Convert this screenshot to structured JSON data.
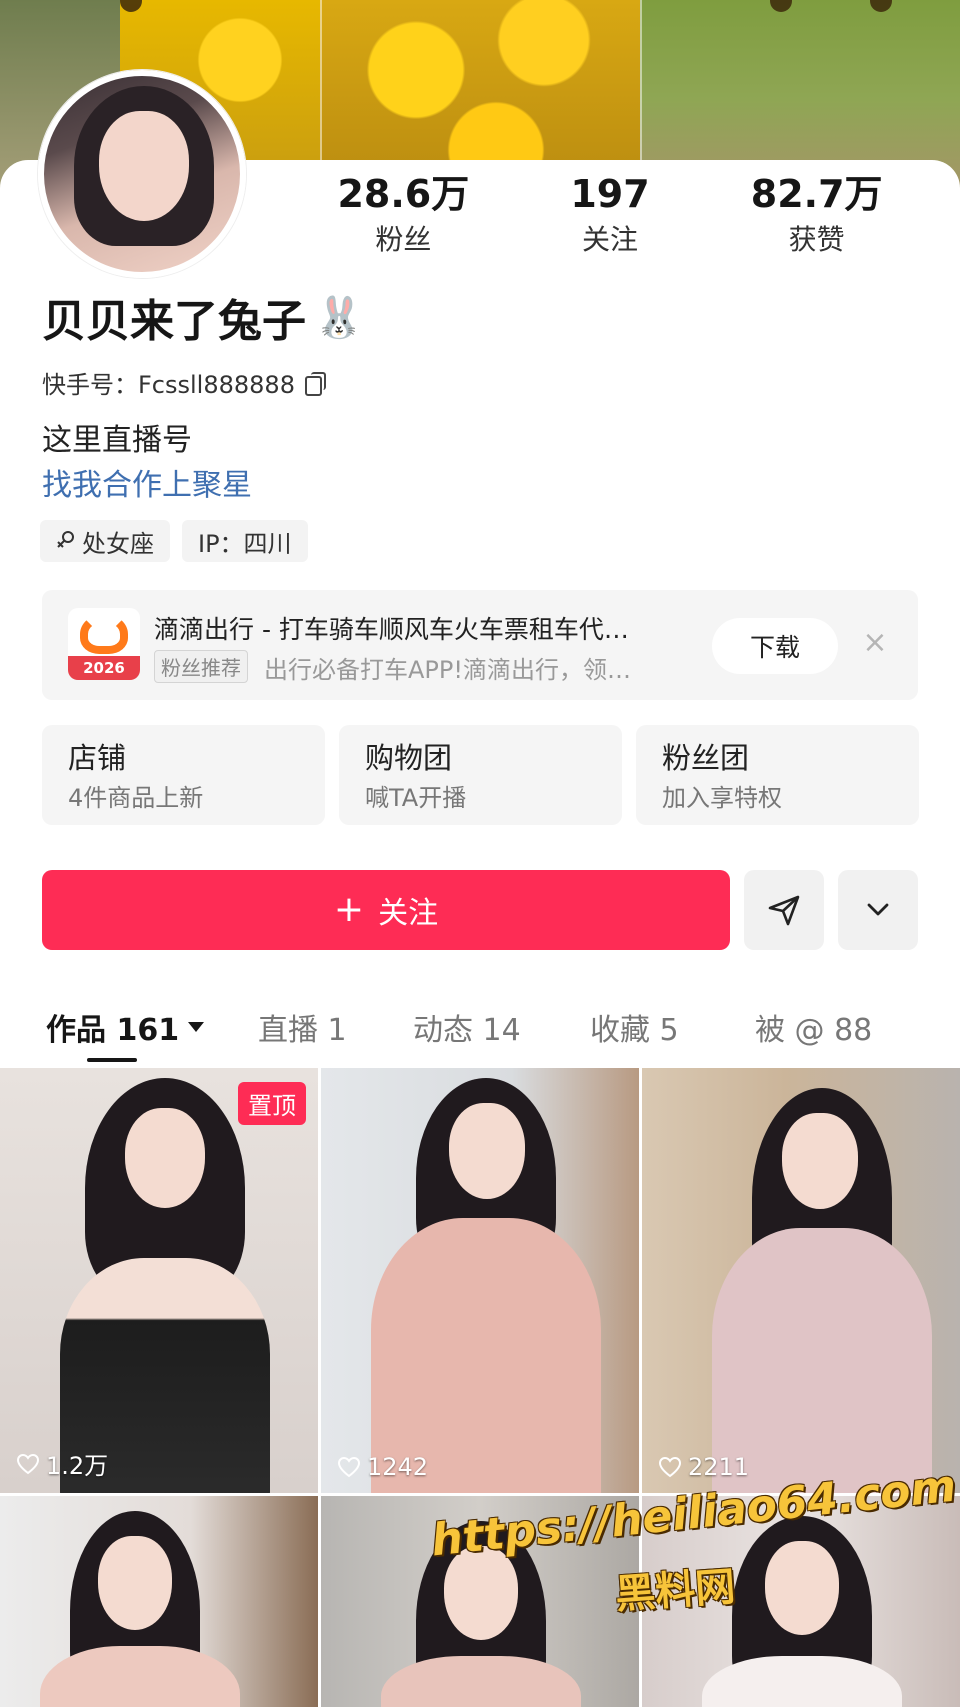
{
  "profile": {
    "stats": [
      {
        "value": "28.6万",
        "label": "粉丝"
      },
      {
        "value": "197",
        "label": "关注"
      },
      {
        "value": "82.7万",
        "label": "获赞"
      }
    ],
    "name": "贝贝来了兔子",
    "name_emoji": "🐰",
    "kuaishou_id": "快手号：Fcssll888888",
    "bio_line1": "这里直播号",
    "bio_line2": "找我合作上聚星",
    "tags": [
      {
        "icon": "female-icon",
        "label": "处女座"
      },
      {
        "label": "IP：四川"
      }
    ]
  },
  "ad": {
    "title": "滴滴出行 - 打车骑车顺风车火车票租车代…",
    "badge": "粉丝推荐",
    "desc": "出行必备打车APP!滴滴出行，领…",
    "logo_year": "2026",
    "button": "下载",
    "close": "×"
  },
  "entries": [
    {
      "title": "店铺",
      "sub": "4件商品上新"
    },
    {
      "title": "购物团",
      "sub": "喊TA开播"
    },
    {
      "title": "粉丝团",
      "sub": "加入享特权"
    }
  ],
  "actions": {
    "follow_plus": "+",
    "follow_label": "关注"
  },
  "tabs": [
    {
      "label": "作品 161",
      "active": true
    },
    {
      "label": "直播 1"
    },
    {
      "label": "动态 14"
    },
    {
      "label": "收藏 5"
    },
    {
      "label": "被 @ 88"
    }
  ],
  "grid": [
    {
      "likes": "1.2万",
      "pinned": "置顶"
    },
    {
      "likes": "1242"
    },
    {
      "likes": "2211"
    }
  ],
  "watermark": {
    "url": "https://heiliao64.com",
    "name": "黑料网"
  },
  "colors": {
    "accent": "#fe2c55",
    "link": "#3f6fb0"
  }
}
